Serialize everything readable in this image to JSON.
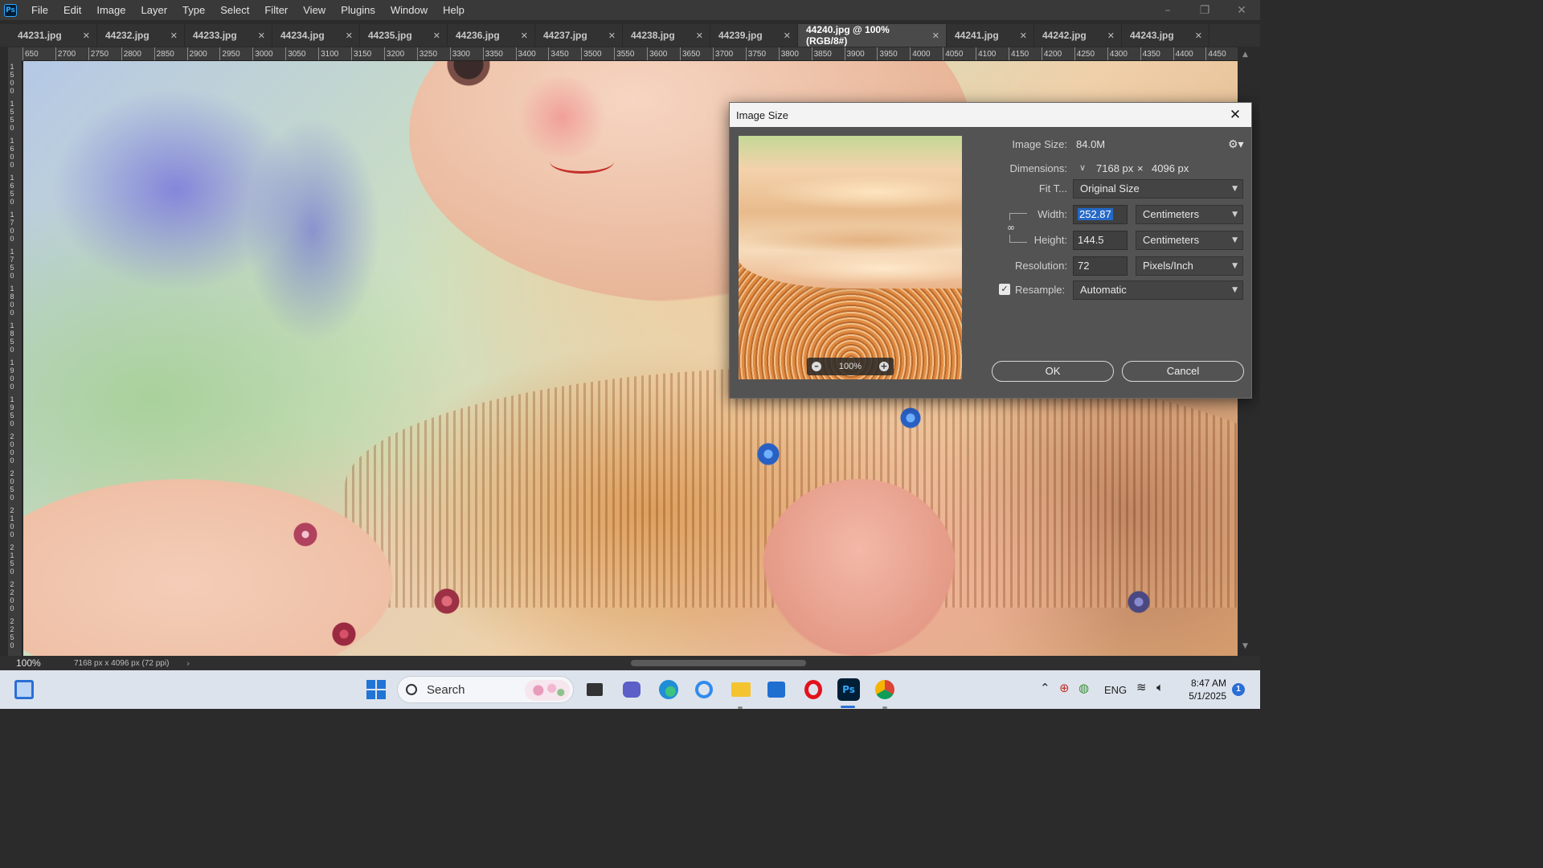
{
  "app": {
    "logo": "Ps",
    "menu": [
      "File",
      "Edit",
      "Image",
      "Layer",
      "Type",
      "Select",
      "Filter",
      "View",
      "Plugins",
      "Window",
      "Help"
    ],
    "window_controls": [
      "minimize-icon",
      "restore-icon",
      "close-icon"
    ]
  },
  "tabs": [
    {
      "label": "44231.jpg",
      "active": false
    },
    {
      "label": "44232.jpg",
      "active": false
    },
    {
      "label": "44233.jpg",
      "active": false
    },
    {
      "label": "44234.jpg",
      "active": false
    },
    {
      "label": "44235.jpg",
      "active": false
    },
    {
      "label": "44236.jpg",
      "active": false
    },
    {
      "label": "44237.jpg",
      "active": false
    },
    {
      "label": "44238.jpg",
      "active": false
    },
    {
      "label": "44239.jpg",
      "active": false
    },
    {
      "label": "44240.jpg @ 100% (RGB/8#)",
      "active": true
    },
    {
      "label": "44241.jpg",
      "active": false
    },
    {
      "label": "44242.jpg",
      "active": false
    },
    {
      "label": "44243.jpg",
      "active": false
    }
  ],
  "ruler": {
    "top_labels": [
      "650",
      "2700",
      "2750",
      "2800",
      "2850",
      "2900",
      "2950",
      "3000",
      "3050",
      "3100",
      "3150",
      "3200",
      "3250",
      "3300",
      "3350",
      "3400",
      "3450",
      "3500",
      "3550",
      "3600",
      "3650",
      "3700",
      "3750",
      "3800",
      "3850",
      "3900",
      "3950",
      "4000",
      "4050",
      "4100",
      "4150",
      "4200",
      "4250",
      "4300",
      "4350",
      "4400",
      "4450",
      "4"
    ],
    "left_labels": [
      "1500",
      "1550",
      "1600",
      "1650",
      "1700",
      "1750",
      "1800",
      "1850",
      "1900",
      "1950",
      "2000",
      "2050",
      "2100",
      "2150",
      "2200",
      "2250"
    ]
  },
  "status": {
    "zoom": "100%",
    "doc_info": "7168 px x 4096 px (72 ppi)",
    "arrow": "›"
  },
  "dialog": {
    "title": "Image Size",
    "preview_zoom": "100%",
    "image_size_label": "Image Size:",
    "image_size_value": "84.0M",
    "dimensions_label": "Dimensions:",
    "dimensions_width": "7168 px",
    "dimensions_times": "×",
    "dimensions_height": "4096 px",
    "fit_to_label": "Fit T...",
    "fit_to_value": "Original Size",
    "width_label": "Width:",
    "width_value": "252.87",
    "width_unit": "Centimeters",
    "height_label": "Height:",
    "height_value": "144.5",
    "height_unit": "Centimeters",
    "resolution_label": "Resolution:",
    "resolution_value": "72",
    "resolution_unit": "Pixels/Inch",
    "resample_label": "Resample:",
    "resample_checked": true,
    "resample_value": "Automatic",
    "ok_label": "OK",
    "cancel_label": "Cancel"
  },
  "taskbar": {
    "search_label": "Search",
    "tray_lang": "ENG",
    "time": "8:47 AM",
    "date": "5/1/2025",
    "notification_count": "1",
    "apps": [
      "task-view-icon",
      "teams-icon",
      "edge-icon",
      "lens-icon",
      "file-explorer-icon",
      "store-icon",
      "opera-icon",
      "photoshop-icon",
      "chrome-icon"
    ],
    "photoshop_app_label": "Ps"
  },
  "colors": {
    "accent": "#31a8ff",
    "selection": "#2469c7",
    "taskbar_accent": "#2a6fd6"
  }
}
